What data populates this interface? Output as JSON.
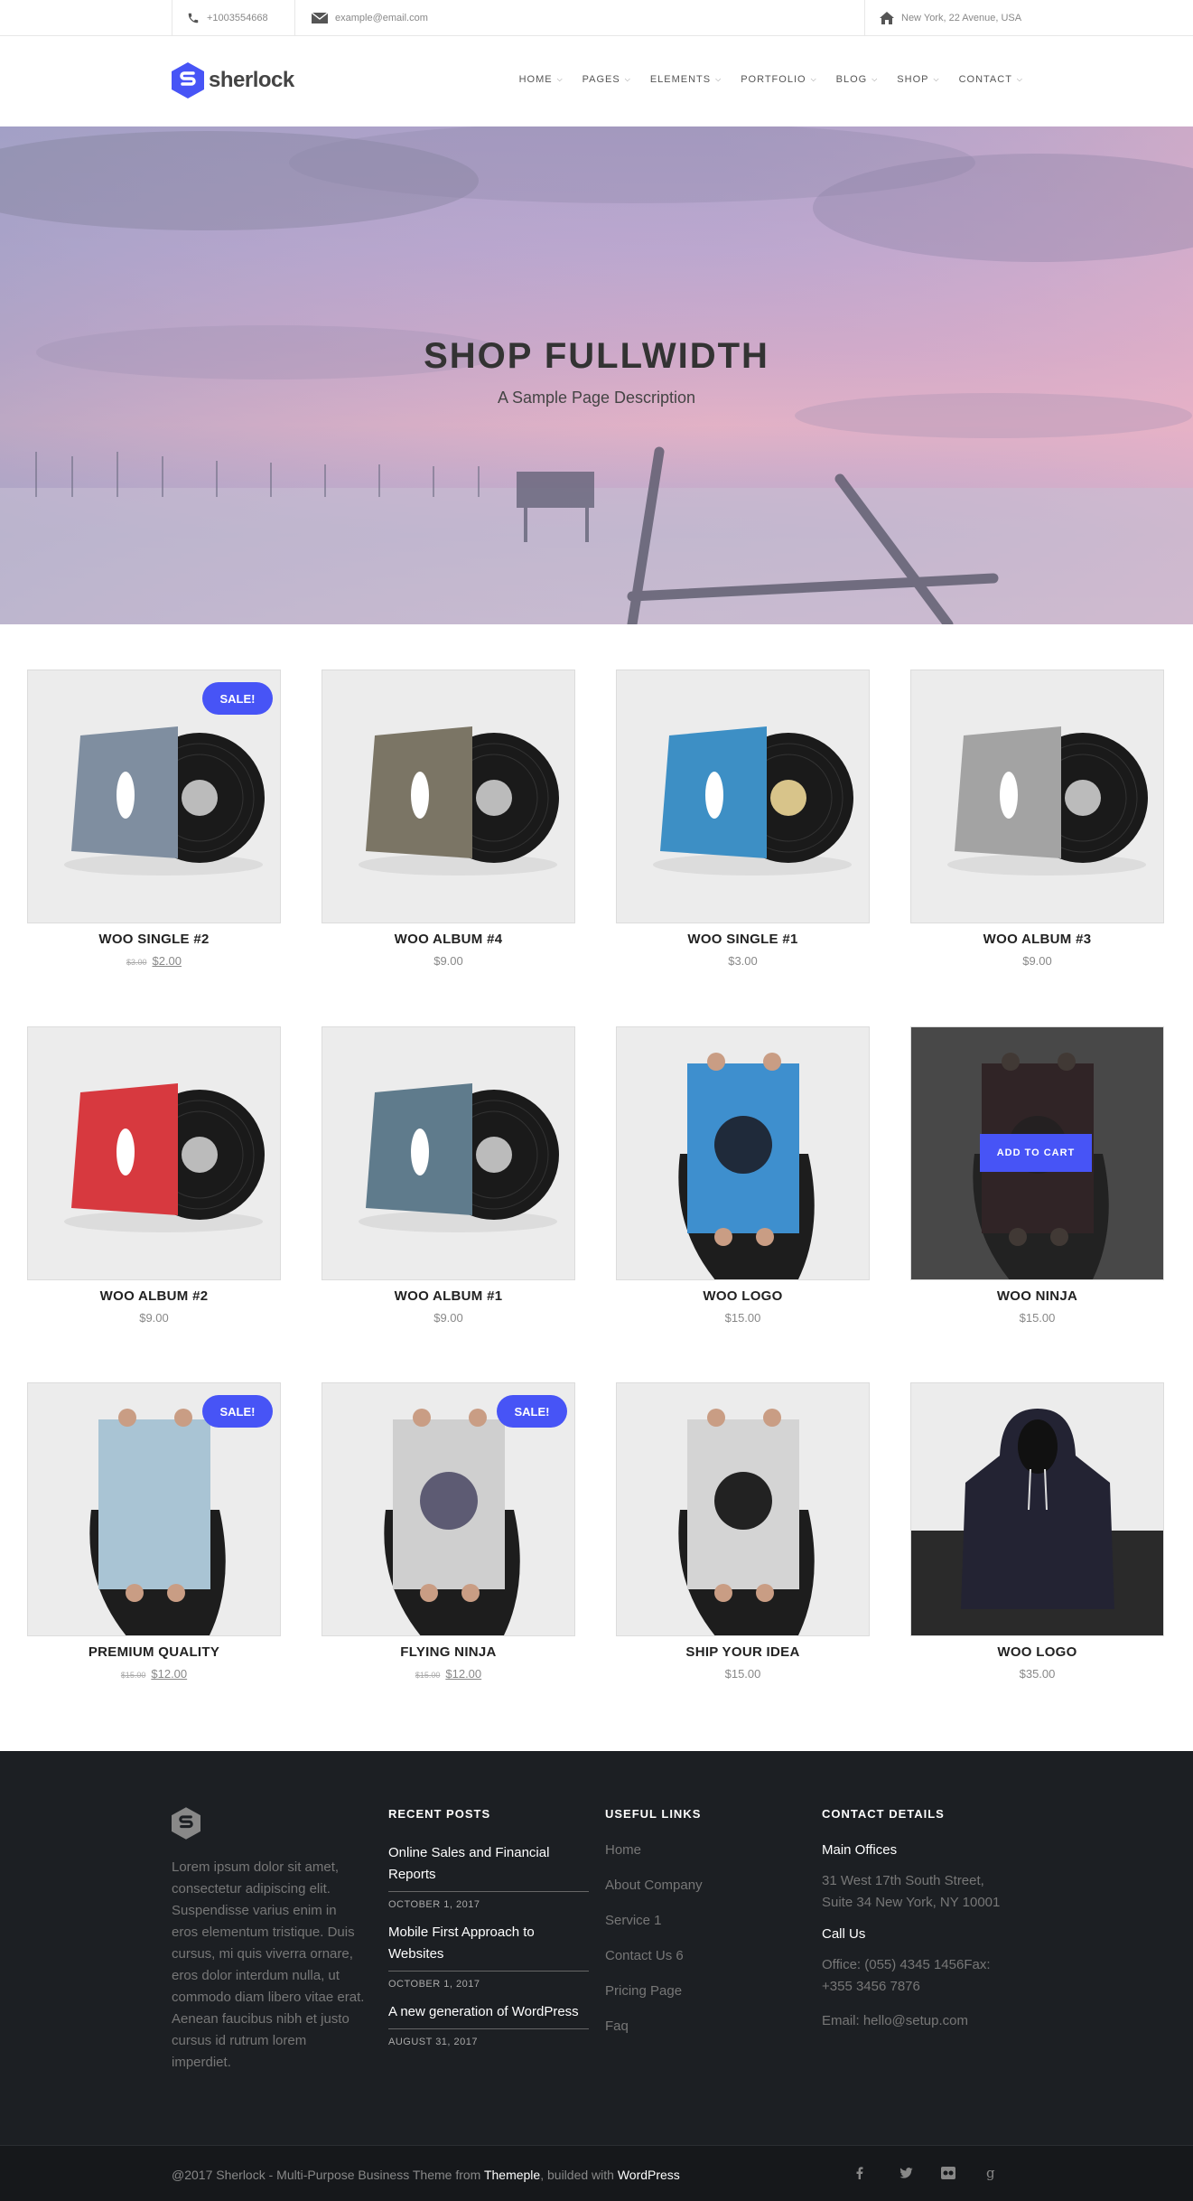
{
  "topbar": {
    "phone": "+1003554668",
    "email": "example@email.com",
    "address": "New York, 22 Avenue, USA"
  },
  "header": {
    "logo_text": "sherlock",
    "nav": [
      "HOME",
      "PAGES",
      "ELEMENTS",
      "PORTFOLIO",
      "BLOG",
      "SHOP",
      "CONTACT"
    ]
  },
  "hero": {
    "title": "SHOP FULLWIDTH",
    "subtitle": "A Sample Page Description"
  },
  "products": [
    {
      "name": "WOO SINGLE #2",
      "old_price": "$3.00",
      "price": "$2.00",
      "sale": "SALE!",
      "image": "vinyl-woo-single-cover"
    },
    {
      "name": "WOO ALBUM #4",
      "price": "$9.00",
      "image": "vinyl-woothemes-cover"
    },
    {
      "name": "WOO SINGLE #1",
      "price": "$3.00",
      "image": "vinyl-woothemes-blue-cover"
    },
    {
      "name": "WOO ALBUM #3",
      "price": "$9.00",
      "image": "vinyl-ninja-grid-cover"
    },
    {
      "name": "WOO ALBUM #2",
      "price": "$9.00",
      "image": "vinyl-woothemes-red-cover"
    },
    {
      "name": "WOO ALBUM #1",
      "price": "$9.00",
      "image": "vinyl-woothemes-slate-cover"
    },
    {
      "name": "WOO LOGO",
      "price": "$15.00",
      "image": "poster-woo-logo"
    },
    {
      "name": "WOO NINJA",
      "price": "$15.00",
      "image": "poster-woo-ninja",
      "hover_button": "ADD TO CART"
    },
    {
      "name": "PREMIUM QUALITY",
      "old_price": "$15.00",
      "price": "$12.00",
      "sale": "SALE!",
      "image": "poster-premium-quality"
    },
    {
      "name": "FLYING NINJA",
      "old_price": "$15.00",
      "price": "$12.00",
      "sale": "SALE!",
      "image": "poster-flying-ninja"
    },
    {
      "name": "SHIP YOUR IDEA",
      "price": "$15.00",
      "image": "poster-ship-your-idea"
    },
    {
      "name": "WOO LOGO",
      "price": "$35.00",
      "image": "hoodie-woo-logo"
    }
  ],
  "footer": {
    "about": "Lorem ipsum dolor sit amet, consectetur adipiscing elit. Suspendisse varius enim in eros elementum tristique. Duis cursus, mi quis viverra ornare, eros dolor interdum nulla, ut commodo diam libero vitae erat. Aenean faucibus nibh et justo cursus id rutrum lorem imperdiet.",
    "recent_posts_title": "RECENT POSTS",
    "posts": [
      {
        "title": "Online Sales and Financial Reports",
        "date": "OCTOBER 1, 2017"
      },
      {
        "title": "Mobile First Approach to Websites",
        "date": "OCTOBER 1, 2017"
      },
      {
        "title": "A new generation of WordPress",
        "date": "AUGUST 31, 2017"
      }
    ],
    "useful_links_title": "USEFUL LINKS",
    "links": [
      "Home",
      "About Company",
      "Service 1",
      "Contact Us 6",
      "Pricing Page",
      "Faq"
    ],
    "contact_title": "CONTACT DETAILS",
    "offices_label": "Main Offices",
    "offices_address": "31 West 17th South Street, Suite 34 New York, NY 10001",
    "call_label": "Call Us",
    "call_value": "Office: (055) 4345 1456Fax: +355 3456 7876",
    "email_value": "Email: hello@setup.com"
  },
  "bottombar": {
    "copy_prefix": "@2017 Sherlock - Multi-Purpose Business Theme from ",
    "copy_link1": "Themeple",
    "copy_mid": ", builded with ",
    "copy_link2": "WordPress",
    "social": [
      "facebook-icon",
      "twitter-icon",
      "flickr-icon",
      "google-plus-icon"
    ]
  },
  "colors": {
    "accent": "#4754f6",
    "footer_bg": "#1c1f23"
  }
}
